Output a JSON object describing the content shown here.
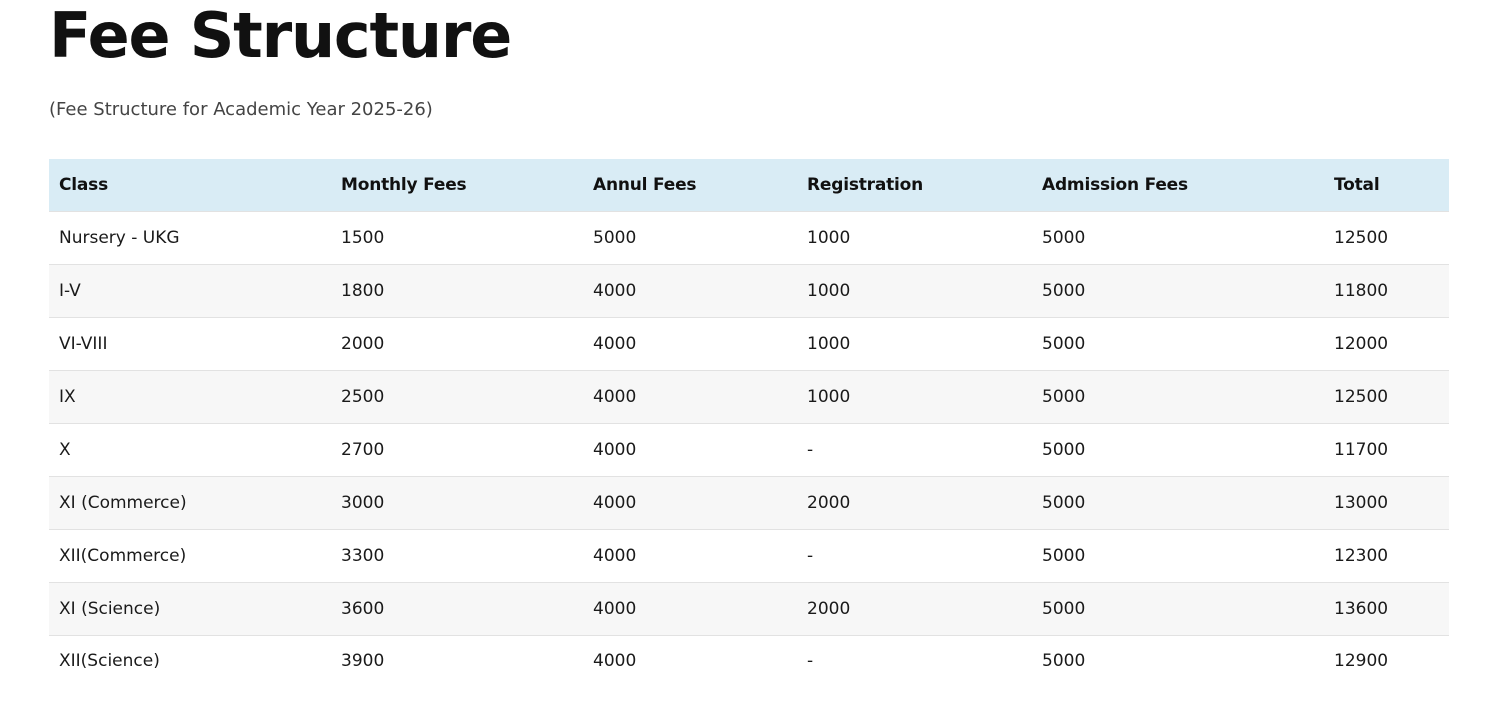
{
  "page": {
    "title": "Fee Structure",
    "subtitle": "(Fee Structure for Academic Year 2025-26)"
  },
  "table": {
    "headers": [
      "Class",
      "Monthly Fees",
      "Annul Fees",
      "Registration",
      "Admission Fees",
      "Total"
    ],
    "rows": [
      [
        "Nursery - UKG",
        "1500",
        "5000",
        "1000",
        "5000",
        "12500"
      ],
      [
        "I-V",
        "1800",
        "4000",
        "1000",
        "5000",
        "11800"
      ],
      [
        "VI-VIII",
        "2000",
        "4000",
        "1000",
        "5000",
        "12000"
      ],
      [
        "IX",
        "2500",
        "4000",
        "1000",
        "5000",
        "12500"
      ],
      [
        "X",
        "2700",
        "4000",
        "-",
        "5000",
        "11700"
      ],
      [
        "XI (Commerce)",
        "3000",
        "4000",
        "2000",
        "5000",
        "13000"
      ],
      [
        "XII(Commerce)",
        "3300",
        "4000",
        "-",
        "5000",
        "12300"
      ],
      [
        "XI (Science)",
        "3600",
        "4000",
        "2000",
        "5000",
        "13600"
      ],
      [
        "XII(Science)",
        "3900",
        "4000",
        "-",
        "5000",
        "12900"
      ]
    ]
  },
  "colors": {
    "header_background": "#d9ecf5",
    "stripe_background": "#f7f7f7",
    "title_text": "#111111"
  }
}
